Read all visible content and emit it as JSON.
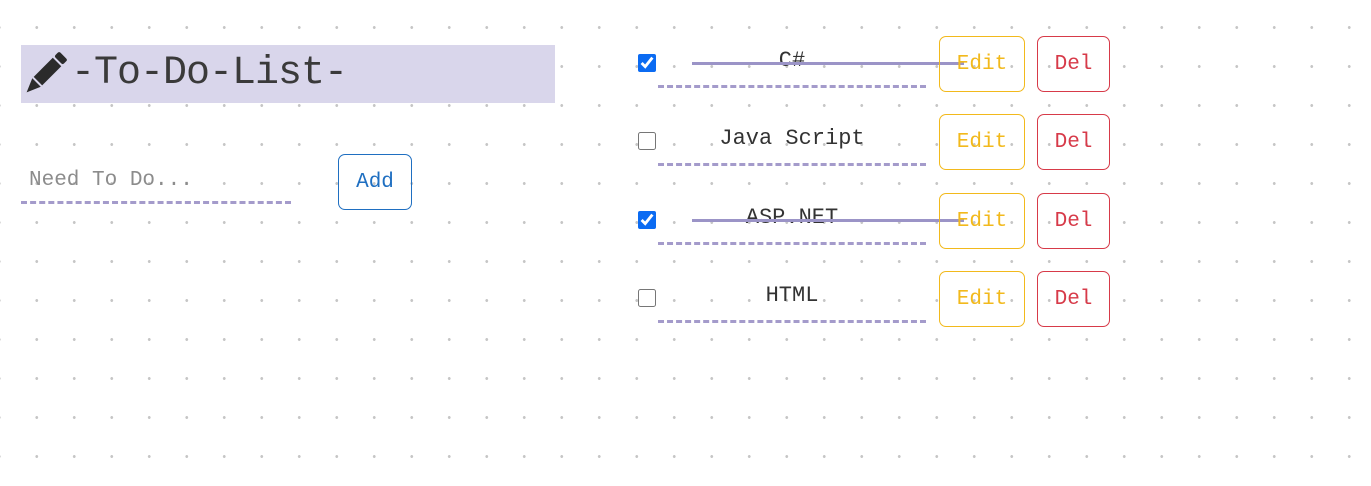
{
  "header": {
    "title": "-To-Do-List-",
    "icon": "pencil-icon"
  },
  "form": {
    "input_placeholder": "Need To Do...",
    "input_value": "",
    "add_label": "Add"
  },
  "tasks": [
    {
      "text": "C#",
      "done": true,
      "edit_label": "Edit",
      "del_label": "Del"
    },
    {
      "text": "Java Script",
      "done": false,
      "edit_label": "Edit",
      "del_label": "Del"
    },
    {
      "text": "ASP.NET",
      "done": true,
      "edit_label": "Edit",
      "del_label": "Del"
    },
    {
      "text": "HTML",
      "done": false,
      "edit_label": "Edit",
      "del_label": "Del"
    }
  ],
  "colors": {
    "header_bg": "#d9d6eb",
    "underline": "#a49bcb",
    "add": "#1f6fc1",
    "edit": "#f2b91c",
    "del": "#d73a49",
    "check": "#0b6bf2"
  }
}
